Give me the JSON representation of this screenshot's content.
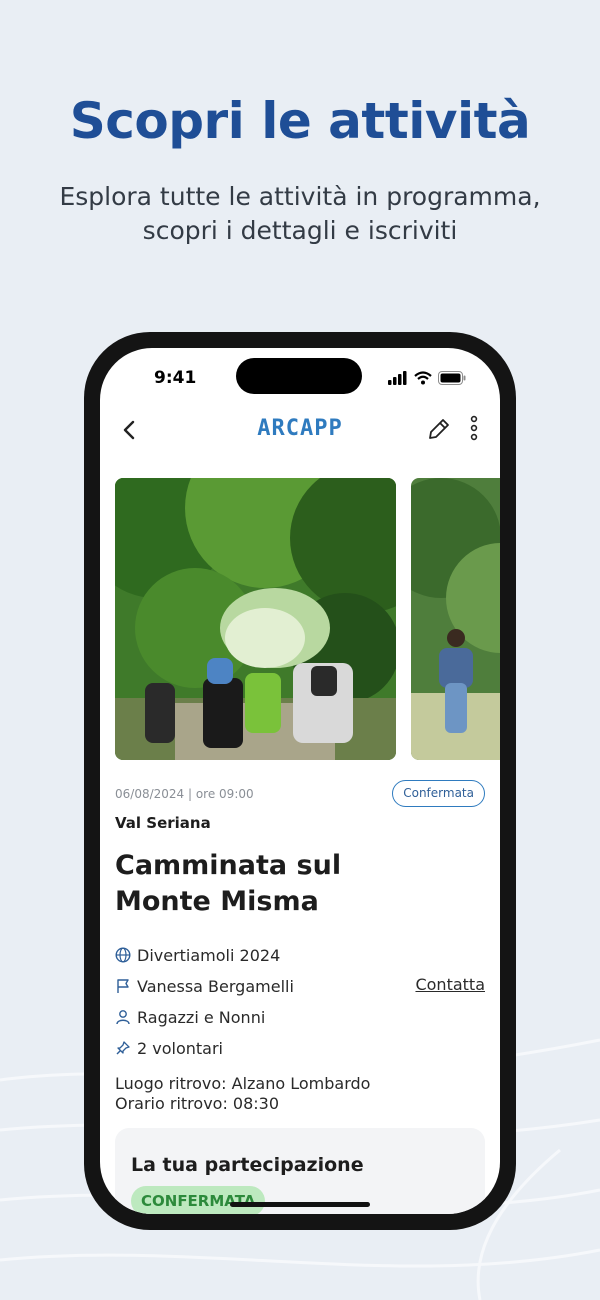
{
  "header": {
    "title": "Scopri le attività",
    "subtitle_line1": "Esplora tutte le attività in programma,",
    "subtitle_line2": "scopri i dettagli e iscriviti"
  },
  "status_bar": {
    "time": "9:41"
  },
  "app_bar": {
    "brand": "ARCAPP"
  },
  "activity": {
    "datetime": "06/08/2024 | ore 09:00",
    "status_badge": "Confermata",
    "area": "Val Seriana",
    "title": "Camminata sul Monte Misma",
    "program": "Divertiamoli 2024",
    "organizer": "Vanessa Bergamelli",
    "contact_label": "Contatta",
    "audience": "Ragazzi e Nonni",
    "volunteers": "2 volontari",
    "meeting_place": "Luogo ritrovo: Alzano Lombardo",
    "meeting_time": "Orario ritrovo: 08:30"
  },
  "participation": {
    "title": "La tua partecipazione",
    "status": "CONFERMATA"
  },
  "colors": {
    "background": "#e9eef4",
    "headline": "#1f4e96",
    "accent": "#2f7bbf",
    "confirmed_green_bg": "#bde9bf",
    "confirmed_green_text": "#2c8a3b"
  },
  "icons": [
    "back-chevron-icon",
    "edit-pencil-icon",
    "more-vertical-icon",
    "globe-icon",
    "flag-icon",
    "person-icon",
    "pin-icon",
    "signal-icon",
    "wifi-icon",
    "battery-icon"
  ]
}
